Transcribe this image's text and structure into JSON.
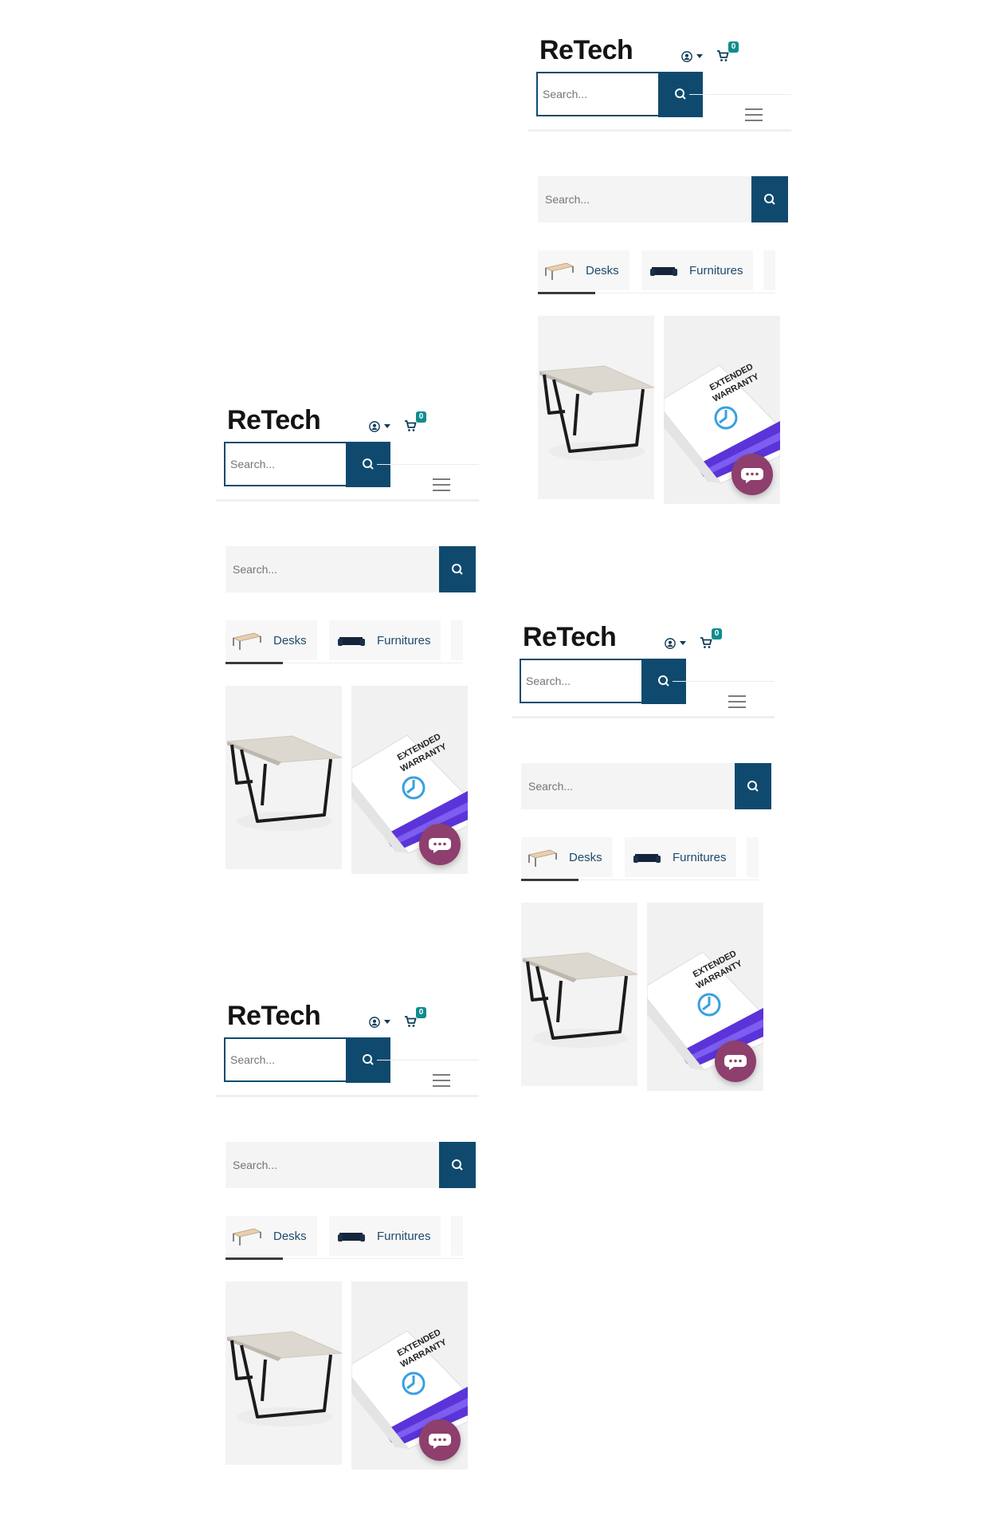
{
  "header": {
    "logo": "ReTech",
    "cart_count": "0",
    "search_placeholder": "Search..."
  },
  "mobile_search": {
    "placeholder": "Search..."
  },
  "category_tabs": [
    {
      "label": "Desks"
    },
    {
      "label": "Furnitures"
    }
  ],
  "products": [
    {
      "image": "white-desk-image"
    },
    {
      "image": "extended-warranty-box-image",
      "text": "EXTENDED WARRANTY"
    }
  ],
  "colors": {
    "brand": "#0f4a6e",
    "badge": "#0f8c8c",
    "chat": "#8e3f6d"
  }
}
